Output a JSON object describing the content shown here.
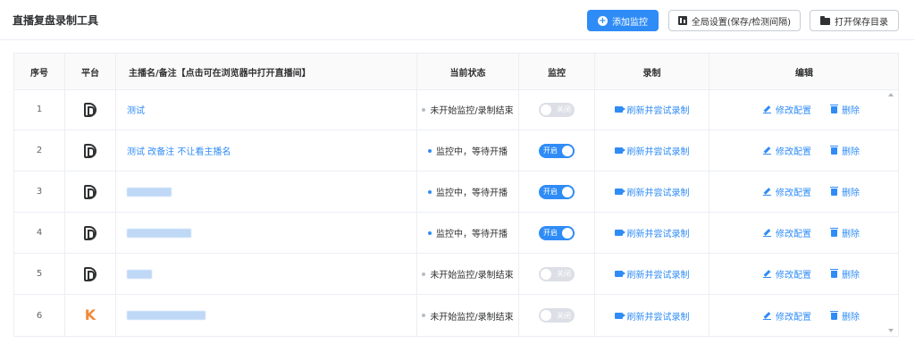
{
  "header": {
    "title": "直播复盘录制工具",
    "add_label": "添加监控",
    "global_label": "全局设置(保存/检测间隔)",
    "open_label": "打开保存目录"
  },
  "table": {
    "columns": [
      "序号",
      "平台",
      "主播名/备注【点击可在浏览器中打开直播间】",
      "当前状态",
      "监控",
      "录制",
      "编辑"
    ],
    "rows": [
      {
        "index": "1",
        "platform": "douyin-logo",
        "name": "测试",
        "blurred": false,
        "status": "未开始监控/录制结束",
        "status_color": "grey",
        "monitor": "关闭",
        "monitor_on": false,
        "record": "刷新并尝试录制",
        "edit": "修改配置",
        "delete": "删除"
      },
      {
        "index": "2",
        "platform": "douyin-logo",
        "name": "测试 改备注 不让看主播名",
        "blurred": false,
        "status": "监控中，等待开播",
        "status_color": "blue",
        "monitor": "开启",
        "monitor_on": true,
        "record": "刷新并尝试录制",
        "edit": "修改配置",
        "delete": "删除"
      },
      {
        "index": "3",
        "platform": "douyin-logo",
        "name": "",
        "blurred": true,
        "status": "监控中，等待开播",
        "status_color": "blue",
        "monitor": "开启",
        "monitor_on": true,
        "record": "刷新并尝试录制",
        "edit": "修改配置",
        "delete": "删除"
      },
      {
        "index": "4",
        "platform": "douyin-logo",
        "name": "",
        "blurred": true,
        "status": "监控中，等待开播",
        "status_color": "blue",
        "monitor": "开启",
        "monitor_on": true,
        "record": "刷新并尝试录制",
        "edit": "修改配置",
        "delete": "删除"
      },
      {
        "index": "5",
        "platform": "douyin-logo",
        "name": "",
        "blurred": true,
        "status": "未开始监控/录制结束",
        "status_color": "grey",
        "monitor": "关闭",
        "monitor_on": false,
        "record": "刷新并尝试录制",
        "edit": "修改配置",
        "delete": "删除"
      },
      {
        "index": "6",
        "platform": "kuaishou-logo",
        "name": "",
        "blurred": true,
        "status": "未开始监控/录制结束",
        "status_color": "grey",
        "monitor": "关闭",
        "monitor_on": false,
        "record": "刷新并尝试录制",
        "edit": "修改配置",
        "delete": "删除"
      }
    ]
  },
  "colors": {
    "accent": "#2f8cf6",
    "kuaishou": "#f08a3a"
  }
}
